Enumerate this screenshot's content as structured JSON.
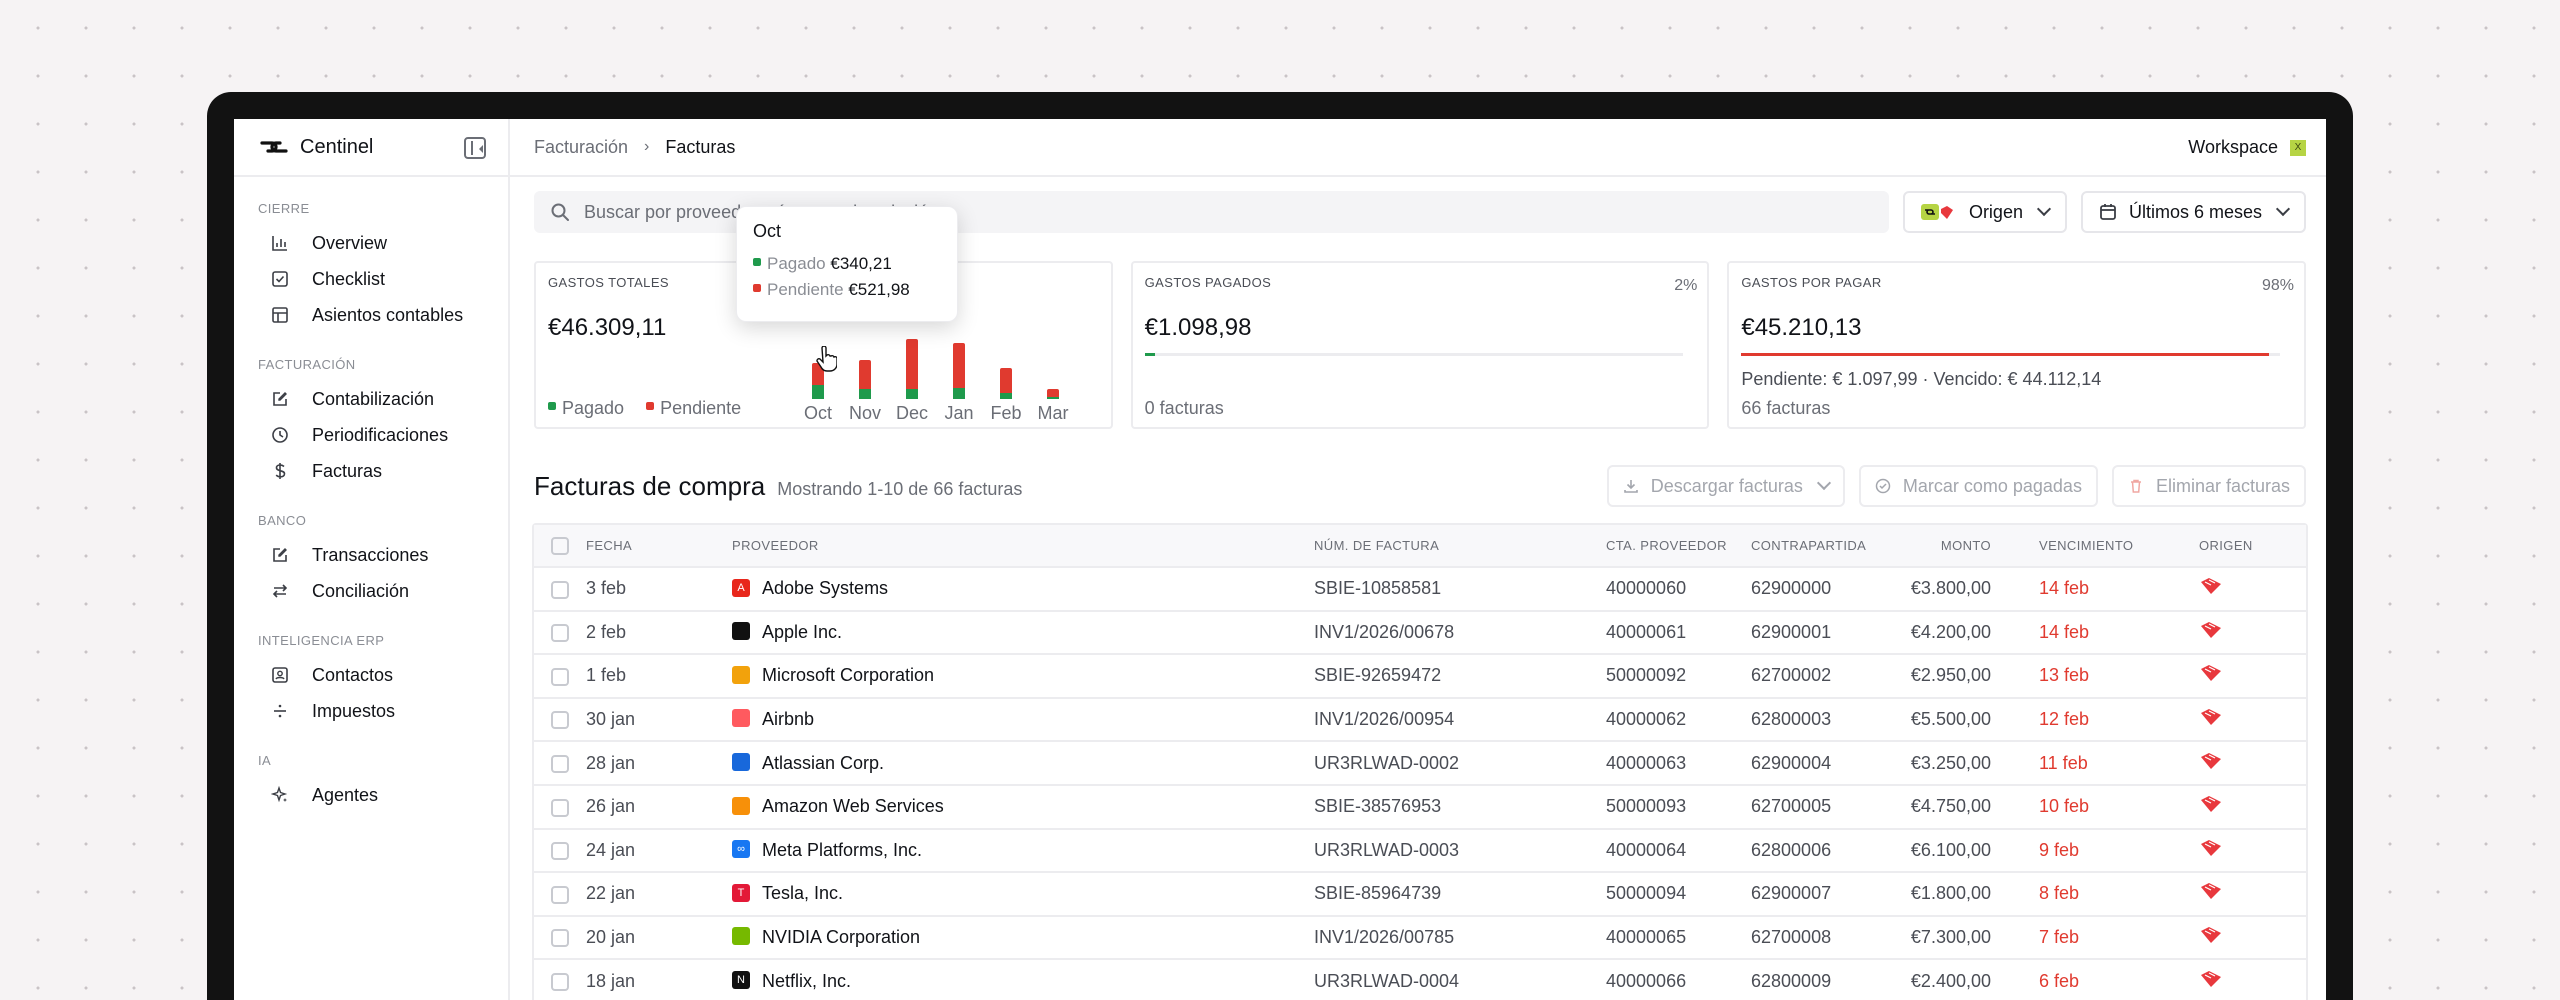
{
  "app": {
    "brand": "Centinel"
  },
  "sidebar": {
    "sections": [
      {
        "heading": "Cierre",
        "items": [
          {
            "label": "Overview",
            "icon": "bar-chart-icon"
          },
          {
            "label": "Checklist",
            "icon": "checklist-icon"
          },
          {
            "label": "Asientos contables",
            "icon": "table-icon"
          }
        ]
      },
      {
        "heading": "Facturación",
        "items": [
          {
            "label": "Contabilización",
            "icon": "edit-icon"
          },
          {
            "label": "Periodificaciones",
            "icon": "clock-icon"
          },
          {
            "label": "Facturas",
            "icon": "dollar-icon"
          }
        ]
      },
      {
        "heading": "Banco",
        "items": [
          {
            "label": "Transacciones",
            "icon": "edit-icon"
          },
          {
            "label": "Conciliación",
            "icon": "swap-icon"
          }
        ]
      },
      {
        "heading": "Inteligencia ERP",
        "items": [
          {
            "label": "Contactos",
            "icon": "contact-icon"
          },
          {
            "label": "Impuestos",
            "icon": "divide-icon"
          }
        ]
      },
      {
        "heading": "IA",
        "items": [
          {
            "label": "Agentes",
            "icon": "sparkle-icon"
          }
        ]
      }
    ]
  },
  "topbar": {
    "crumb_parent": "Facturación",
    "crumb_current": "Facturas",
    "workspace": "Workspace",
    "workspace_badge": "X"
  },
  "search": {
    "placeholder": "Buscar por proveedor, número o descripción..."
  },
  "filters": {
    "origen": "Origen",
    "period": "Últimos 6 meses"
  },
  "cards": {
    "total": {
      "label": "Gastos totales",
      "value": "€46.309,11",
      "legend_paid": "Pagado",
      "legend_pending": "Pendiente"
    },
    "paid": {
      "label": "Gastos pagados",
      "value": "€1.098,98",
      "pct": "2%",
      "pct_fill": 0.02,
      "footer": "0 facturas"
    },
    "topay": {
      "label": "Gastos por pagar",
      "value": "€45.210,13",
      "pct": "98%",
      "pct_fill": 0.98,
      "detail": "Pendiente: € 1.097,99 · Vencido: € 44.112,14",
      "footer": "66 facturas"
    }
  },
  "chart_data": {
    "type": "bar",
    "categories": [
      "Oct",
      "Nov",
      "Dec",
      "Jan",
      "Feb",
      "Mar"
    ],
    "series": [
      {
        "name": "Pagado",
        "color": "#1f9a4c",
        "values": [
          340.21,
          250,
          250,
          260,
          150,
          60
        ]
      },
      {
        "name": "Pendiente",
        "color": "#e03a2f",
        "values": [
          521.98,
          700,
          1200,
          1100,
          600,
          180
        ]
      }
    ]
  },
  "tooltip": {
    "title": "Oct",
    "paid_label": "Pagado",
    "paid_value": "€340,21",
    "pending_label": "Pendiente",
    "pending_value": "€521,98"
  },
  "section": {
    "title": "Facturas de compra",
    "subtitle": "Mostrando 1-10 de 66 facturas"
  },
  "actions": {
    "download": "Descargar facturas",
    "mark_paid": "Marcar como pagadas",
    "delete": "Eliminar facturas"
  },
  "table": {
    "headers": [
      "Fecha",
      "Proveedor",
      "Núm. de factura",
      "Cta. proveedor",
      "Contrapartida",
      "Monto",
      "Vencimiento",
      "Origen"
    ],
    "rows": [
      {
        "fecha": "3 feb",
        "proveedor": "Adobe Systems",
        "logo_color": "#e8271c",
        "logo": "A",
        "factura": "SBIE-10858581",
        "cta": "40000060",
        "contra": "62900000",
        "monto": "€3.800,00",
        "venc": "14 feb"
      },
      {
        "fecha": "2 feb",
        "proveedor": "Apple Inc.",
        "logo_color": "#111111",
        "logo": "",
        "factura": "INV1/2026/00678",
        "cta": "40000061",
        "contra": "62900001",
        "monto": "€4.200,00",
        "venc": "14 feb"
      },
      {
        "fecha": "1 feb",
        "proveedor": "Microsoft Corporation",
        "logo_color": "#f2a20c",
        "logo": "",
        "factura": "SBIE-92659472",
        "cta": "50000092",
        "contra": "62700002",
        "monto": "€2.950,00",
        "venc": "13 feb"
      },
      {
        "fecha": "30 jan",
        "proveedor": "Airbnb",
        "logo_color": "#ff5a5f",
        "logo": "",
        "factura": "INV1/2026/00954",
        "cta": "40000062",
        "contra": "62800003",
        "monto": "€5.500,00",
        "venc": "12 feb"
      },
      {
        "fecha": "28 jan",
        "proveedor": "Atlassian Corp.",
        "logo_color": "#1868db",
        "logo": "",
        "factura": "UR3RLWAD-0002",
        "cta": "40000063",
        "contra": "62900004",
        "monto": "€3.250,00",
        "venc": "11 feb"
      },
      {
        "fecha": "26 jan",
        "proveedor": "Amazon Web Services",
        "logo_color": "#f79009",
        "logo": "",
        "factura": "SBIE-38576953",
        "cta": "50000093",
        "contra": "62700005",
        "monto": "€4.750,00",
        "venc": "10 feb"
      },
      {
        "fecha": "24 jan",
        "proveedor": "Meta Platforms, Inc.",
        "logo_color": "#1877f2",
        "logo": "∞",
        "factura": "UR3RLWAD-0003",
        "cta": "40000064",
        "contra": "62800006",
        "monto": "€6.100,00",
        "venc": "9 feb"
      },
      {
        "fecha": "22 jan",
        "proveedor": "Tesla, Inc.",
        "logo_color": "#e31937",
        "logo": "T",
        "factura": "SBIE-85964739",
        "cta": "50000094",
        "contra": "62900007",
        "monto": "€1.800,00",
        "venc": "8 feb"
      },
      {
        "fecha": "20 jan",
        "proveedor": "NVIDIA Corporation",
        "logo_color": "#76b900",
        "logo": "",
        "factura": "INV1/2026/00785",
        "cta": "40000065",
        "contra": "62700008",
        "monto": "€7.300,00",
        "venc": "7 feb"
      },
      {
        "fecha": "18 jan",
        "proveedor": "Netflix, Inc.",
        "logo_color": "#111111",
        "logo": "N",
        "factura": "UR3RLWAD-0004",
        "cta": "40000066",
        "contra": "62800009",
        "monto": "€2.400,00",
        "venc": "6 feb"
      }
    ]
  },
  "colors": {
    "paid": "#1f9a4c",
    "pending": "#e03a2f",
    "accent": "#e03a2f"
  }
}
